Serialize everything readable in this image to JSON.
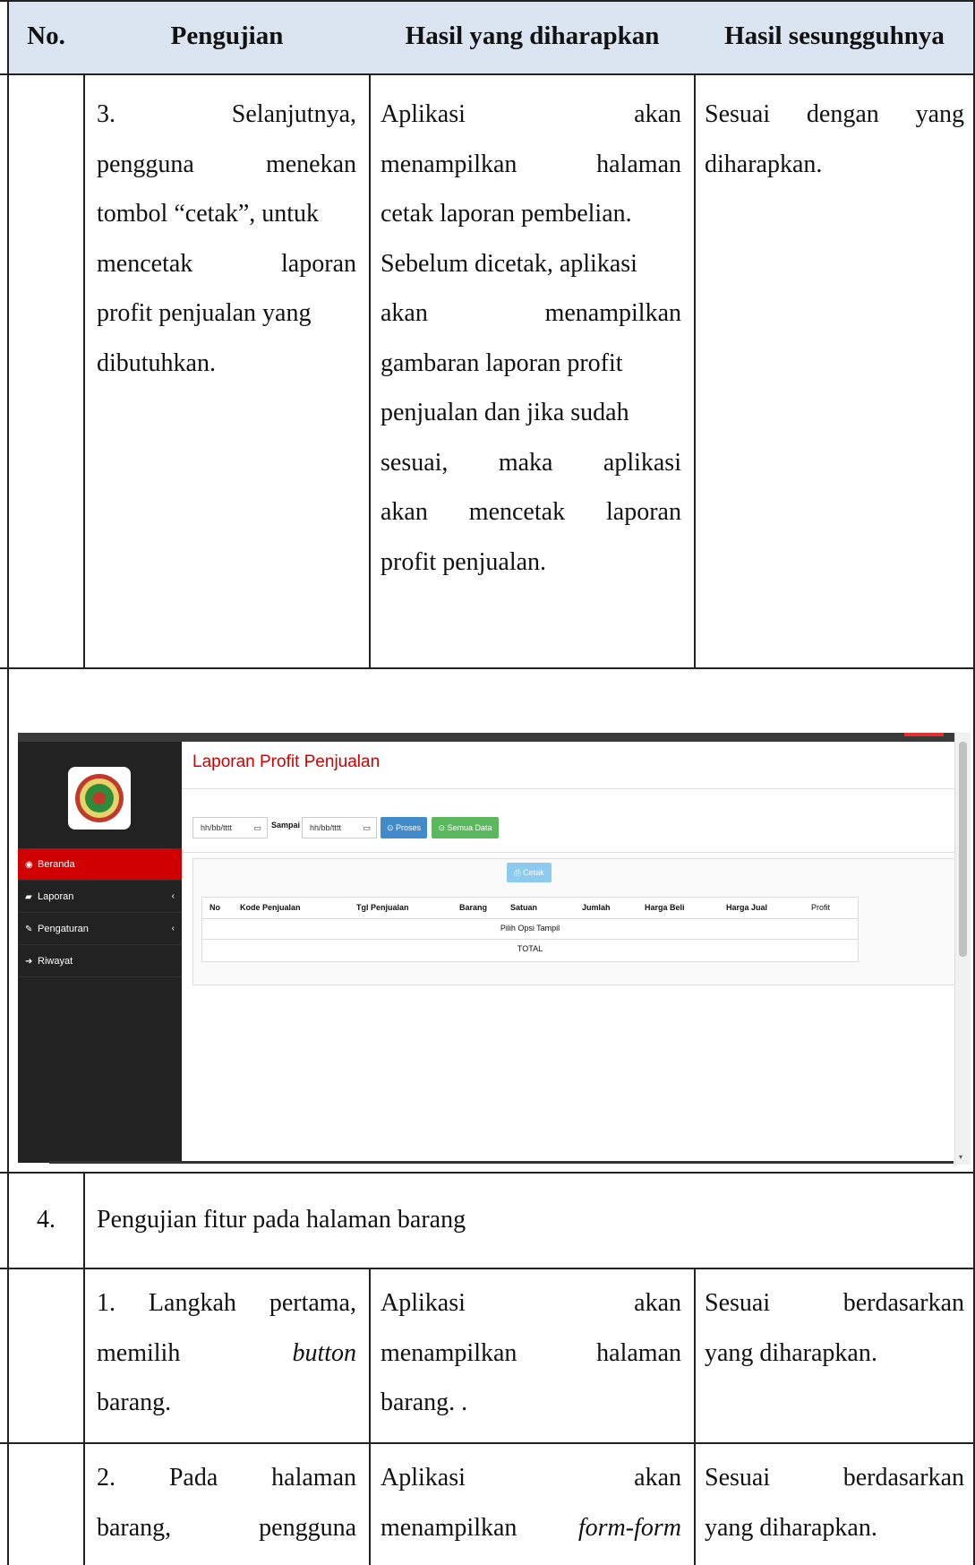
{
  "table": {
    "headers": [
      "No.",
      "Pengujian",
      "Hasil yang diharapkan",
      "Hasil sesungguhnya"
    ],
    "row_a": {
      "pengujian": [
        "3.",
        "Selanjutnya,",
        "pengguna",
        "menekan",
        "tombol “cetak”, untuk",
        "mencetak",
        "laporan",
        "profit penjualan yang",
        "dibutuhkan."
      ],
      "harapan": [
        "Aplikasi",
        "akan",
        "menampilkan",
        "halaman",
        "cetak laporan pembelian.",
        "Sebelum dicetak, aplikasi",
        "akan",
        "menampilkan",
        "gambaran laporan profit",
        "penjualan dan jika sudah",
        "sesuai,",
        "maka",
        "aplikasi",
        "akan",
        "mencetak",
        "laporan",
        "profit penjualan."
      ],
      "hasil": [
        "Sesuai",
        "dengan",
        "yang",
        "diharapkan."
      ]
    },
    "row_4": {
      "no": "4.",
      "title": "Pengujian fitur pada halaman barang"
    },
    "row_b": {
      "pengujian": [
        "1.",
        "Langkah",
        "pertama,",
        "memilih",
        "button",
        "barang."
      ],
      "harapan": [
        "Aplikasi",
        "akan",
        "menampilkan",
        "halaman",
        "barang. ."
      ],
      "hasil": [
        "Sesuai",
        "berdasarkan",
        "yang diharapkan."
      ]
    },
    "row_c": {
      "pengujian": [
        "2.",
        "Pada",
        "halaman",
        "barang,",
        "pengguna"
      ],
      "harapan": [
        "Aplikasi",
        "akan",
        "menampilkan",
        "form-form"
      ],
      "hasil": [
        "Sesuai",
        "berdasarkan",
        "yang diharapkan."
      ]
    }
  },
  "screenshot": {
    "page_title": "Laporan Profit Penjualan",
    "nav": [
      "Beranda",
      "Laporan",
      "Pengaturan",
      "Riwayat"
    ],
    "date_placeholder": "hh/bb/tttt",
    "sampai_label": "Sampai",
    "proses_label": "Proses",
    "semua_label": "Semua Data",
    "cetak_label": "Cetak",
    "columns": [
      "No",
      "Kode Penjualan",
      "Tgl Penjualan",
      "Barang",
      "Satuan",
      "Jumlah",
      "Harga Beli",
      "Harga Jual",
      "Profit"
    ],
    "empty_text": "Pilih Opsi Tampil",
    "total_text": "TOTAL",
    "colors": {
      "accent": "#d10000",
      "proses": "#428bca",
      "semua": "#5cb85c",
      "cetak": "#8ccaf0"
    }
  }
}
